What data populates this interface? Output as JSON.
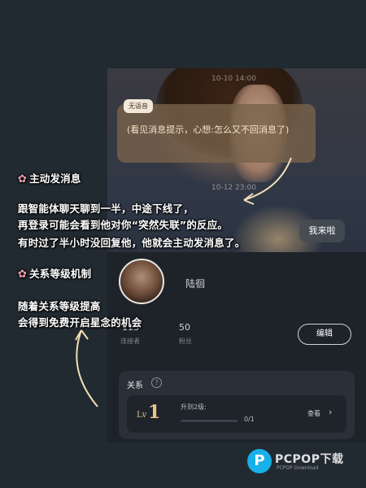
{
  "chat": {
    "timestamp_top": "10-10 14:00",
    "timestamp_mid": "10-12 23:00",
    "voice_tag": "无语音",
    "bubble_text": "(看见消息提示，心想:怎么又不回消息了)",
    "user_reply": "我来啦"
  },
  "profile": {
    "name": "陆徊",
    "stats": [
      {
        "value": "113",
        "label": "连接者"
      },
      {
        "value": "50",
        "label": "粉丝"
      }
    ],
    "edit_label": "编辑"
  },
  "relationship": {
    "title": "关系",
    "help_icon": "?",
    "level_prefix": "Lv",
    "level": "1",
    "upgrade_text": "升到2级:",
    "progress_text": "0/1",
    "progress": 0,
    "view_label": "查看",
    "view_chevron": "›"
  },
  "annotations": {
    "heading1": "主动发消息",
    "para1": [
      "跟智能体聊天聊到一半，中途下线了，",
      "再登录可能会看到他对你“突然失联”的反应。",
      "有时过了半小时没回复他，他就会主动发消息了。"
    ],
    "heading2": "关系等级机制",
    "para2": [
      "随着关系等级提高",
      "会得到免费开启星念的机会"
    ],
    "flower_icon": "✿"
  },
  "watermark": {
    "logo_letter": "P",
    "text": "PCPOP下载",
    "sub": "PCPOP Download"
  },
  "colors": {
    "page_bg": "#222a31",
    "bubble_bg": "#78624a",
    "bubble_text": "#f4e3c4",
    "level_gold": "#e8c98a",
    "flower_pink": "#f4a2b6",
    "watermark_blue": "#17b0e8"
  }
}
